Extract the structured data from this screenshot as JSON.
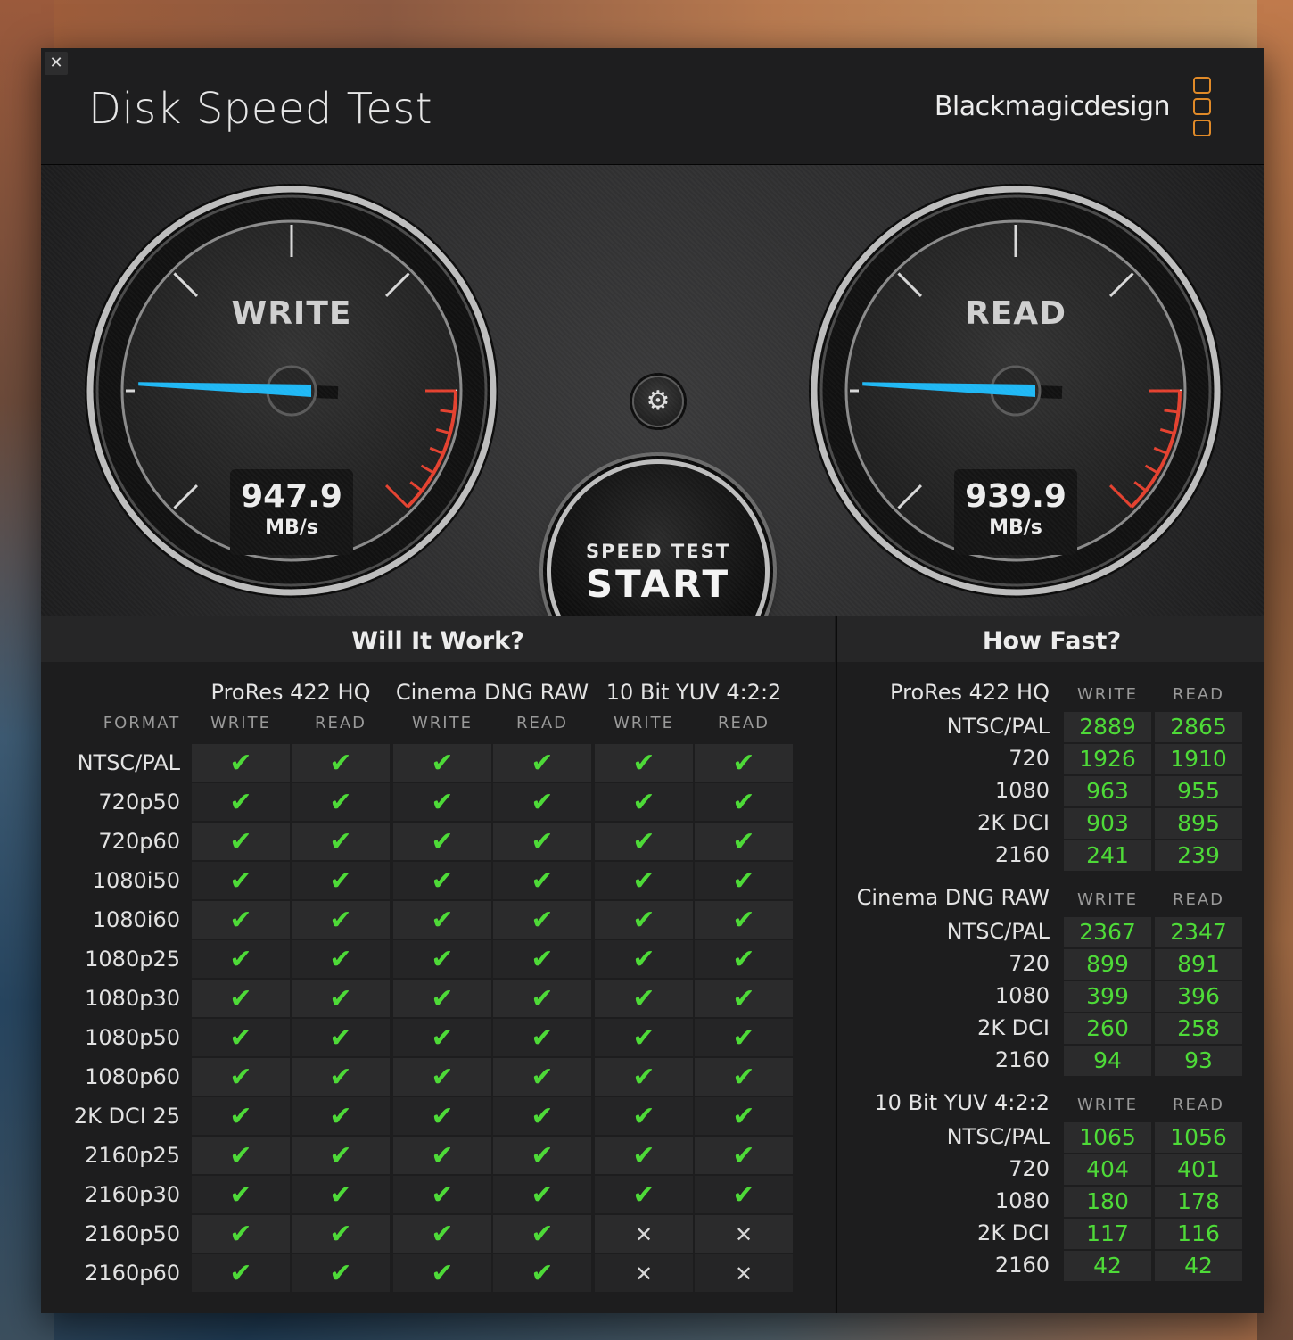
{
  "app": {
    "title": "Disk Speed Test",
    "brand": "Blackmagicdesign",
    "close_glyph": "✕",
    "accent_color": "#e08a28"
  },
  "gauges": {
    "write": {
      "label": "WRITE",
      "value": "947.9",
      "unit": "MB/s"
    },
    "read": {
      "label": "READ",
      "value": "939.9",
      "unit": "MB/s"
    },
    "needle_color": "#1fb8f5",
    "redline_color": "#e4412f"
  },
  "controls": {
    "settings_icon": "gear-icon",
    "start_small": "SPEED TEST",
    "start_big": "START"
  },
  "will_it_work": {
    "title": "Will It Work?",
    "format_header": "FORMAT",
    "groups": [
      "ProRes 422 HQ",
      "Cinema DNG RAW",
      "10 Bit YUV 4:2:2"
    ],
    "sub_headers": [
      "WRITE",
      "READ",
      "WRITE",
      "READ",
      "WRITE",
      "READ"
    ],
    "check_glyph": "✔",
    "cross_glyph": "✕",
    "check_color": "#4eda38",
    "rows": [
      {
        "format": "NTSC/PAL",
        "results": [
          true,
          true,
          true,
          true,
          true,
          true
        ]
      },
      {
        "format": "720p50",
        "results": [
          true,
          true,
          true,
          true,
          true,
          true
        ]
      },
      {
        "format": "720p60",
        "results": [
          true,
          true,
          true,
          true,
          true,
          true
        ]
      },
      {
        "format": "1080i50",
        "results": [
          true,
          true,
          true,
          true,
          true,
          true
        ]
      },
      {
        "format": "1080i60",
        "results": [
          true,
          true,
          true,
          true,
          true,
          true
        ]
      },
      {
        "format": "1080p25",
        "results": [
          true,
          true,
          true,
          true,
          true,
          true
        ]
      },
      {
        "format": "1080p30",
        "results": [
          true,
          true,
          true,
          true,
          true,
          true
        ]
      },
      {
        "format": "1080p50",
        "results": [
          true,
          true,
          true,
          true,
          true,
          true
        ]
      },
      {
        "format": "1080p60",
        "results": [
          true,
          true,
          true,
          true,
          true,
          true
        ]
      },
      {
        "format": "2K DCI 25",
        "results": [
          true,
          true,
          true,
          true,
          true,
          true
        ]
      },
      {
        "format": "2160p25",
        "results": [
          true,
          true,
          true,
          true,
          true,
          true
        ]
      },
      {
        "format": "2160p30",
        "results": [
          true,
          true,
          true,
          true,
          true,
          true
        ]
      },
      {
        "format": "2160p50",
        "results": [
          true,
          true,
          true,
          true,
          false,
          false
        ]
      },
      {
        "format": "2160p60",
        "results": [
          true,
          true,
          true,
          true,
          false,
          false
        ]
      }
    ]
  },
  "how_fast": {
    "title": "How Fast?",
    "write_label": "WRITE",
    "read_label": "READ",
    "groups": [
      {
        "name": "ProRes 422 HQ",
        "rows": [
          {
            "label": "NTSC/PAL",
            "write": "2889",
            "read": "2865"
          },
          {
            "label": "720",
            "write": "1926",
            "read": "1910"
          },
          {
            "label": "1080",
            "write": "963",
            "read": "955"
          },
          {
            "label": "2K DCI",
            "write": "903",
            "read": "895"
          },
          {
            "label": "2160",
            "write": "241",
            "read": "239"
          }
        ]
      },
      {
        "name": "Cinema DNG RAW",
        "rows": [
          {
            "label": "NTSC/PAL",
            "write": "2367",
            "read": "2347"
          },
          {
            "label": "720",
            "write": "899",
            "read": "891"
          },
          {
            "label": "1080",
            "write": "399",
            "read": "396"
          },
          {
            "label": "2K DCI",
            "write": "260",
            "read": "258"
          },
          {
            "label": "2160",
            "write": "94",
            "read": "93"
          }
        ]
      },
      {
        "name": "10 Bit YUV 4:2:2",
        "rows": [
          {
            "label": "NTSC/PAL",
            "write": "1065",
            "read": "1056"
          },
          {
            "label": "720",
            "write": "404",
            "read": "401"
          },
          {
            "label": "1080",
            "write": "180",
            "read": "178"
          },
          {
            "label": "2K DCI",
            "write": "117",
            "read": "116"
          },
          {
            "label": "2160",
            "write": "42",
            "read": "42"
          }
        ]
      }
    ]
  }
}
